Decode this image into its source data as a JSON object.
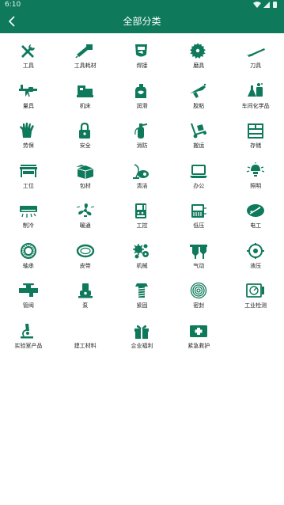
{
  "status_bar": {
    "time": "6:10"
  },
  "header": {
    "title": "全部分类",
    "back_icon": "back-arrow-icon"
  },
  "colors": {
    "accent": "#0e7a5b",
    "icon": "#0e7a5b"
  },
  "categories": [
    {
      "label": "工具",
      "icon": "tools-icon"
    },
    {
      "label": "工具耗材",
      "icon": "tool-consumables-icon"
    },
    {
      "label": "焊接",
      "icon": "welding-icon"
    },
    {
      "label": "磨具",
      "icon": "abrasive-disc-icon"
    },
    {
      "label": "刀具",
      "icon": "cutter-icon"
    },
    {
      "label": "量具",
      "icon": "caliper-icon"
    },
    {
      "label": "机床",
      "icon": "machine-tool-icon"
    },
    {
      "label": "润滑",
      "icon": "lubricant-icon"
    },
    {
      "label": "胶粘",
      "icon": "glue-gun-icon"
    },
    {
      "label": "车间化学品",
      "icon": "chemicals-icon"
    },
    {
      "label": "劳保",
      "icon": "glove-icon"
    },
    {
      "label": "安全",
      "icon": "lock-icon"
    },
    {
      "label": "消防",
      "icon": "fire-extinguisher-icon"
    },
    {
      "label": "搬运",
      "icon": "hand-truck-icon"
    },
    {
      "label": "存储",
      "icon": "storage-cabinet-icon"
    },
    {
      "label": "工位",
      "icon": "workbench-icon"
    },
    {
      "label": "包材",
      "icon": "packaging-box-icon"
    },
    {
      "label": "清洁",
      "icon": "vacuum-cleaner-icon"
    },
    {
      "label": "办公",
      "icon": "laptop-icon"
    },
    {
      "label": "照明",
      "icon": "lamp-icon"
    },
    {
      "label": "制冷",
      "icon": "air-conditioner-icon"
    },
    {
      "label": "暖通",
      "icon": "fan-icon"
    },
    {
      "label": "工控",
      "icon": "controller-icon"
    },
    {
      "label": "低压",
      "icon": "low-voltage-icon"
    },
    {
      "label": "电工",
      "icon": "electrician-icon"
    },
    {
      "label": "轴承",
      "icon": "bearing-icon"
    },
    {
      "label": "皮带",
      "icon": "belt-icon"
    },
    {
      "label": "机械",
      "icon": "gears-icon"
    },
    {
      "label": "气动",
      "icon": "pneumatic-icon"
    },
    {
      "label": "液压",
      "icon": "hydraulic-icon"
    },
    {
      "label": "管阀",
      "icon": "pipe-valve-icon"
    },
    {
      "label": "泵",
      "icon": "pump-icon"
    },
    {
      "label": "紧固",
      "icon": "bolt-icon"
    },
    {
      "label": "密封",
      "icon": "seal-ring-icon"
    },
    {
      "label": "工业检测",
      "icon": "meter-icon"
    },
    {
      "label": "实验室产品",
      "icon": "microscope-icon"
    },
    {
      "label": "建工材料",
      "icon": ""
    },
    {
      "label": "企业福利",
      "icon": "gift-icon"
    },
    {
      "label": "紧急救护",
      "icon": "first-aid-icon"
    }
  ]
}
